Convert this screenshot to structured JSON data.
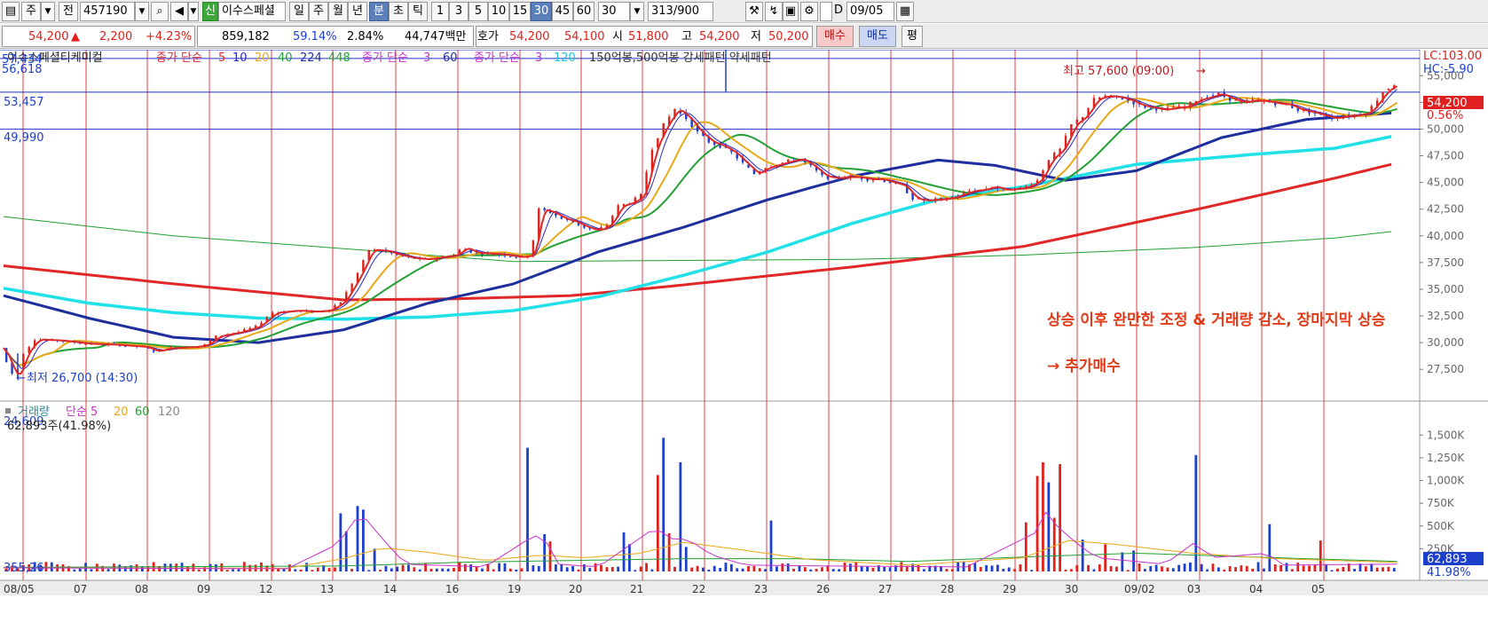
{
  "toolbar": {
    "period_sel": "주",
    "scope": "전",
    "code": "457190",
    "market_badge": "신",
    "stock_name": "이수스페셜",
    "period_buttons": [
      "일",
      "주",
      "월",
      "년",
      "분",
      "초",
      "틱"
    ],
    "active_period": "분",
    "interval_buttons": [
      "1",
      "3",
      "5",
      "10",
      "15",
      "30",
      "45",
      "60"
    ],
    "active_interval": "30",
    "interval_input": "30",
    "count": "313",
    "count_total": "/900",
    "d_label": "D",
    "date": "09/05"
  },
  "quote": {
    "price": "54,200",
    "arrow": "▲",
    "change": "2,200",
    "change_pct": "+4.23%",
    "volume": "859,182",
    "vol_ratio": "59.14%",
    "turnover": "2.84%",
    "amount": "44,747백만",
    "hoga_label": "호가",
    "ask": "54,200",
    "bid": "54,100",
    "open_label": "시",
    "open": "51,800",
    "high_label": "고",
    "high": "54,200",
    "low_label": "저",
    "low": "50,200",
    "buy_label": "매수",
    "sell_label": "매도",
    "eval_label": "평"
  },
  "colors": {
    "up": "#e0201a",
    "down": "#1c3fcc",
    "ma5": "#e02828",
    "ma10": "#2828c8",
    "ma20": "#e8a818",
    "ma40": "#22a035",
    "ma224": "#1e2e9c",
    "ma448": "#20e0e8",
    "vol_ma5": "#c832c8",
    "vol_ma20": "#e8a818",
    "vol_ma60": "#22a035",
    "grid_red": "#e24040",
    "level_blue": "#2030c8"
  },
  "chart_data": [
    {
      "type": "candlestick",
      "title": "이수스페셜티케미컬",
      "legend": [
        {
          "group": "종가 단순",
          "periods": [
            "5",
            "10",
            "20",
            "40",
            "224",
            "448"
          ]
        },
        {
          "group": "종가 단순",
          "periods": [
            "3",
            "60"
          ]
        },
        {
          "group": "종가 단순",
          "periods": [
            "3",
            "120"
          ]
        },
        {
          "text": "150억봉,500억봉 강세패턴  약세패턴"
        }
      ],
      "x_ticks": [
        "08/05",
        "07",
        "08",
        "09",
        "12",
        "13",
        "14",
        "16",
        "19",
        "20",
        "21",
        "22",
        "23",
        "26",
        "27",
        "28",
        "29",
        "30",
        "09/02",
        "03",
        "04",
        "05"
      ],
      "y_ticks": [
        "55,000",
        "52,500",
        "50,000",
        "47,500",
        "45,000",
        "42,500",
        "40,000",
        "37,500",
        "35,000",
        "32,500",
        "30,000",
        "27,500"
      ],
      "ylim": [
        24609,
        57434
      ],
      "corner_labels": {
        "top_max": "57,434",
        "top_second": "56,618",
        "bottom_min": "24,609"
      },
      "right_labels": {
        "lc": "LC:103.00",
        "hc": "HC:-5.90",
        "current": "54,200",
        "current_pct": "0.56%"
      },
      "level_lines": [
        {
          "value": 57434,
          "label": ""
        },
        {
          "value": 56618,
          "label": ""
        },
        {
          "value": 53457,
          "label": "53,457"
        },
        {
          "value": 49990,
          "label": "49,990"
        }
      ],
      "annotations": [
        {
          "text": "최고 57,600 (09:00)",
          "x_index": 255
        },
        {
          "text": "최저 26,700 (14:30)",
          "x_index": 3
        },
        {
          "text": "상승 이후 완만한 조정 & 거래량 감소, 장마지막 상승"
        },
        {
          "text": "→ 추가매수"
        }
      ],
      "price_path": [
        [
          0,
          29500
        ],
        [
          3,
          27500
        ],
        [
          5,
          26700
        ],
        [
          8,
          29000
        ],
        [
          12,
          30300
        ],
        [
          20,
          30200
        ],
        [
          30,
          29900
        ],
        [
          40,
          29800
        ],
        [
          50,
          29600
        ],
        [
          54,
          29200
        ],
        [
          60,
          29500
        ],
        [
          68,
          29600
        ],
        [
          72,
          29800
        ],
        [
          76,
          30600
        ],
        [
          84,
          31000
        ],
        [
          90,
          31500
        ],
        [
          96,
          32800
        ],
        [
          104,
          33000
        ],
        [
          110,
          32900
        ],
        [
          115,
          33000
        ],
        [
          120,
          33800
        ],
        [
          125,
          36000
        ],
        [
          130,
          38700
        ],
        [
          135,
          38600
        ],
        [
          140,
          38200
        ],
        [
          145,
          37900
        ],
        [
          150,
          37800
        ],
        [
          155,
          38000
        ],
        [
          160,
          38200
        ],
        [
          163,
          38900
        ],
        [
          167,
          38400
        ],
        [
          175,
          38300
        ],
        [
          183,
          38000
        ],
        [
          187,
          38200
        ],
        [
          190,
          42500
        ],
        [
          194,
          42200
        ],
        [
          198,
          41600
        ],
        [
          202,
          41300
        ],
        [
          206,
          40800
        ],
        [
          210,
          40500
        ],
        [
          214,
          41000
        ],
        [
          218,
          42800
        ],
        [
          222,
          43100
        ],
        [
          226,
          43800
        ],
        [
          230,
          48200
        ],
        [
          234,
          50400
        ],
        [
          238,
          51900
        ],
        [
          242,
          51000
        ],
        [
          246,
          49700
        ],
        [
          250,
          48800
        ],
        [
          254,
          48400
        ],
        [
          258,
          47800
        ],
        [
          262,
          46800
        ],
        [
          266,
          45800
        ],
        [
          270,
          46400
        ],
        [
          274,
          46700
        ],
        [
          278,
          47000
        ],
        [
          282,
          47200
        ],
        [
          286,
          46500
        ],
        [
          290,
          45600
        ],
        [
          294,
          45400
        ],
        [
          298,
          45500
        ],
        [
          302,
          45500
        ],
        [
          306,
          45300
        ],
        [
          310,
          45300
        ],
        [
          314,
          45000
        ],
        [
          318,
          44700
        ],
        [
          322,
          43500
        ],
        [
          326,
          43300
        ],
        [
          330,
          43400
        ],
        [
          334,
          43500
        ],
        [
          338,
          43800
        ],
        [
          342,
          44200
        ],
        [
          346,
          44300
        ],
        [
          350,
          44600
        ],
        [
          354,
          44300
        ],
        [
          358,
          44400
        ],
        [
          362,
          44600
        ],
        [
          366,
          45200
        ],
        [
          370,
          47200
        ],
        [
          374,
          48100
        ],
        [
          378,
          50400
        ],
        [
          382,
          51200
        ],
        [
          386,
          52800
        ],
        [
          390,
          53100
        ],
        [
          394,
          53000
        ],
        [
          398,
          52700
        ],
        [
          402,
          52200
        ],
        [
          406,
          52000
        ],
        [
          410,
          51800
        ],
        [
          414,
          52000
        ],
        [
          418,
          52100
        ],
        [
          422,
          52700
        ],
        [
          426,
          53000
        ],
        [
          430,
          53300
        ],
        [
          434,
          52800
        ],
        [
          438,
          52500
        ],
        [
          442,
          52700
        ],
        [
          446,
          52600
        ],
        [
          450,
          52400
        ],
        [
          454,
          52300
        ],
        [
          458,
          51800
        ],
        [
          462,
          51600
        ],
        [
          466,
          51300
        ],
        [
          470,
          51000
        ],
        [
          474,
          51200
        ],
        [
          478,
          51300
        ],
        [
          482,
          51500
        ],
        [
          485,
          52400
        ],
        [
          488,
          53500
        ],
        [
          492,
          54200
        ]
      ],
      "ma224_path": [
        [
          0,
          34400
        ],
        [
          30,
          32300
        ],
        [
          60,
          30500
        ],
        [
          90,
          30000
        ],
        [
          120,
          31200
        ],
        [
          150,
          33700
        ],
        [
          180,
          35500
        ],
        [
          210,
          38500
        ],
        [
          240,
          40800
        ],
        [
          270,
          43400
        ],
        [
          300,
          45600
        ],
        [
          330,
          47100
        ],
        [
          350,
          46600
        ],
        [
          375,
          45200
        ],
        [
          400,
          46100
        ],
        [
          430,
          49200
        ],
        [
          460,
          50900
        ],
        [
          490,
          51500
        ]
      ],
      "ma448_path": [
        [
          0,
          35100
        ],
        [
          30,
          33700
        ],
        [
          60,
          32800
        ],
        [
          90,
          32300
        ],
        [
          120,
          32200
        ],
        [
          150,
          32400
        ],
        [
          180,
          33000
        ],
        [
          210,
          34300
        ],
        [
          240,
          36300
        ],
        [
          270,
          38500
        ],
        [
          300,
          41200
        ],
        [
          330,
          43400
        ],
        [
          360,
          44600
        ],
        [
          400,
          46700
        ],
        [
          440,
          47600
        ],
        [
          470,
          48200
        ],
        [
          490,
          49300
        ]
      ],
      "red_long_path": [
        [
          0,
          37200
        ],
        [
          60,
          35500
        ],
        [
          120,
          34000
        ],
        [
          160,
          34100
        ],
        [
          200,
          34400
        ],
        [
          240,
          35400
        ],
        [
          300,
          37100
        ],
        [
          360,
          39000
        ],
        [
          420,
          42400
        ],
        [
          470,
          45400
        ],
        [
          490,
          46700
        ]
      ],
      "green_long_path": [
        [
          0,
          41800
        ],
        [
          60,
          40000
        ],
        [
          120,
          38800
        ],
        [
          180,
          37600
        ],
        [
          240,
          37700
        ],
        [
          300,
          37800
        ],
        [
          360,
          38200
        ],
        [
          420,
          38900
        ],
        [
          470,
          39800
        ],
        [
          490,
          40400
        ]
      ],
      "volume": {
        "legend": [
          {
            "label": "거래량"
          },
          {
            "label": "단순 5"
          },
          {
            "label": "20"
          },
          {
            "label": "60"
          },
          {
            "label": "120"
          }
        ],
        "info": "62,893주(41.98%)",
        "y_ticks": [
          "1,500K",
          "1,250K",
          "1,000K",
          "750K",
          "500K",
          "250K"
        ],
        "ylim": [
          0,
          1600000
        ],
        "current": "62,893",
        "current_pct": "41.98%",
        "corner_value": "355,26",
        "spikes": [
          [
            118,
            640000
          ],
          [
            119,
            1340000
          ],
          [
            121,
            440000
          ],
          [
            124,
            720000
          ],
          [
            126,
            680000
          ],
          [
            130,
            250000
          ],
          [
            184,
            1360000
          ],
          [
            191,
            410000
          ],
          [
            192,
            330000
          ],
          [
            218,
            430000
          ],
          [
            220,
            300000
          ],
          [
            230,
            1060000
          ],
          [
            232,
            1470000
          ],
          [
            234,
            420000
          ],
          [
            238,
            1200000
          ],
          [
            240,
            270000
          ],
          [
            270,
            560000
          ],
          [
            360,
            540000
          ],
          [
            364,
            1050000
          ],
          [
            366,
            1200000
          ],
          [
            368,
            980000
          ],
          [
            370,
            590000
          ],
          [
            372,
            1180000
          ],
          [
            380,
            350000
          ],
          [
            388,
            300000
          ],
          [
            394,
            210000
          ],
          [
            398,
            230000
          ],
          [
            421,
            1280000
          ],
          [
            446,
            520000
          ],
          [
            464,
            340000
          ]
        ],
        "ma5_path": [
          [
            0,
            40000
          ],
          [
            100,
            30000
          ],
          [
            118,
            300000
          ],
          [
            126,
            650000
          ],
          [
            134,
            350000
          ],
          [
            142,
            80000
          ],
          [
            170,
            50000
          ],
          [
            184,
            330000
          ],
          [
            190,
            420000
          ],
          [
            196,
            80000
          ],
          [
            210,
            50000
          ],
          [
            230,
            480000
          ],
          [
            236,
            360000
          ],
          [
            242,
            350000
          ],
          [
            250,
            180000
          ],
          [
            262,
            70000
          ],
          [
            290,
            60000
          ],
          [
            340,
            50000
          ],
          [
            364,
            420000
          ],
          [
            368,
            650000
          ],
          [
            372,
            500000
          ],
          [
            378,
            330000
          ],
          [
            386,
            150000
          ],
          [
            410,
            80000
          ],
          [
            421,
            330000
          ],
          [
            426,
            150000
          ],
          [
            446,
            200000
          ],
          [
            452,
            70000
          ],
          [
            492,
            80000
          ]
        ],
        "ma20_path": [
          [
            0,
            40000
          ],
          [
            100,
            35000
          ],
          [
            120,
            140000
          ],
          [
            134,
            260000
          ],
          [
            150,
            210000
          ],
          [
            170,
            120000
          ],
          [
            190,
            180000
          ],
          [
            205,
            150000
          ],
          [
            225,
            200000
          ],
          [
            240,
            320000
          ],
          [
            260,
            240000
          ],
          [
            285,
            130000
          ],
          [
            320,
            70000
          ],
          [
            360,
            150000
          ],
          [
            376,
            340000
          ],
          [
            392,
            300000
          ],
          [
            420,
            200000
          ],
          [
            450,
            140000
          ],
          [
            492,
            100000
          ]
        ],
        "ma60_path": [
          [
            0,
            45000
          ],
          [
            120,
            60000
          ],
          [
            160,
            100000
          ],
          [
            200,
            120000
          ],
          [
            240,
            140000
          ],
          [
            280,
            140000
          ],
          [
            320,
            110000
          ],
          [
            370,
            170000
          ],
          [
            400,
            200000
          ],
          [
            440,
            160000
          ],
          [
            492,
            110000
          ]
        ]
      }
    }
  ]
}
